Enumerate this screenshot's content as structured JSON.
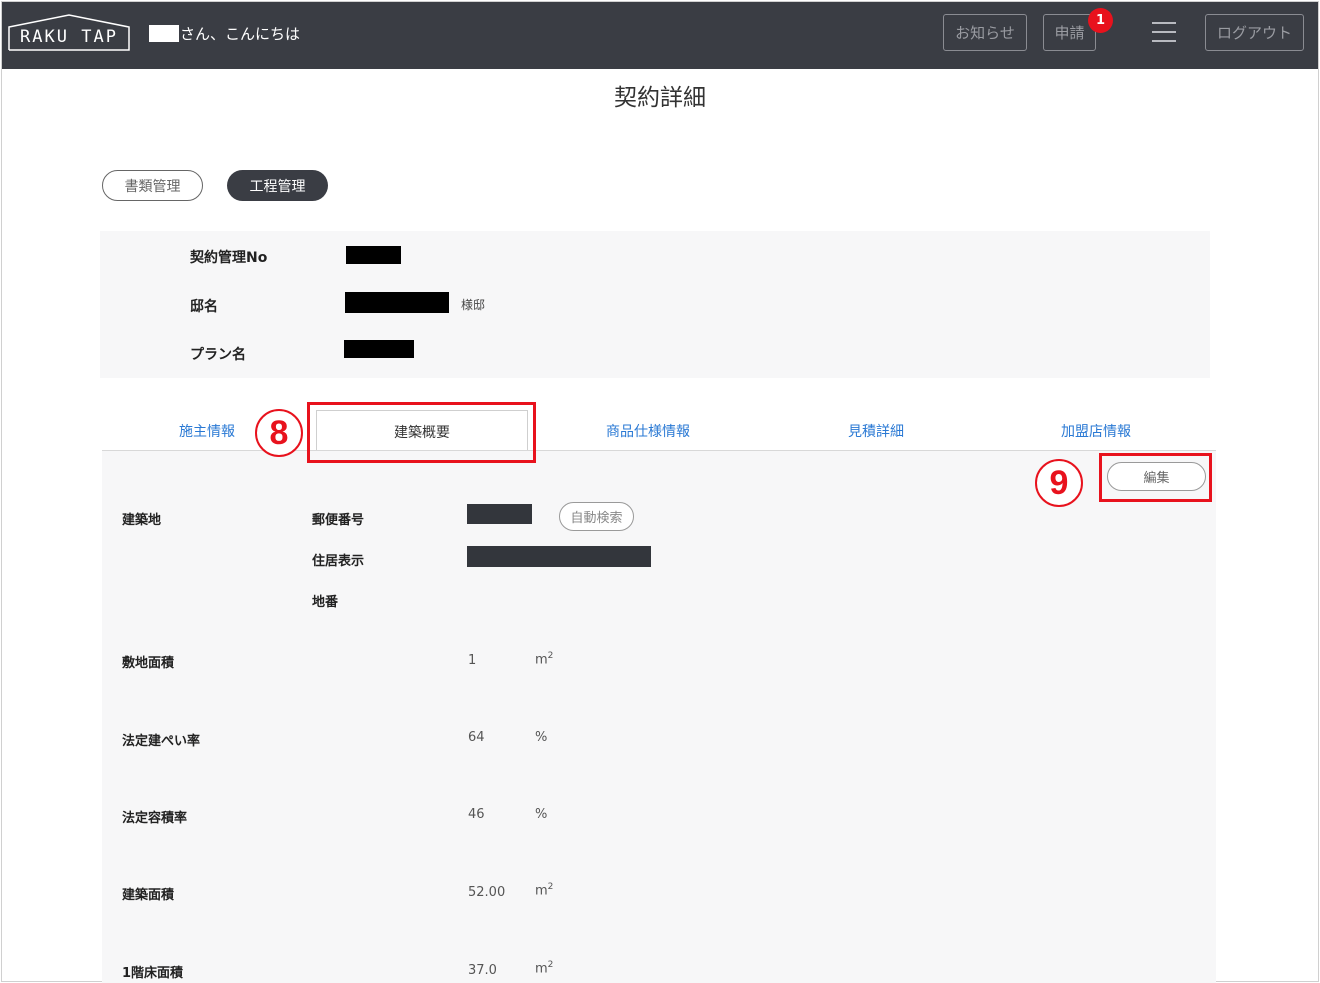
{
  "header": {
    "logo": "RAKU TAP",
    "greeting": "さん、こんにちは",
    "notice_label": "お知らせ",
    "apply_label": "申請",
    "apply_badge": "1",
    "logout_label": "ログアウト"
  },
  "page_title": "契約詳細",
  "pill_tabs": {
    "docs": "書類管理",
    "process": "工程管理"
  },
  "info": {
    "contract_no_label": "契約管理No",
    "house_name_label": "邸名",
    "house_suffix": "様邸",
    "plan_name_label": "プラン名"
  },
  "sub_tabs": {
    "owner": "施主情報",
    "building": "建築概要",
    "spec": "商品仕様情報",
    "estimate": "見積詳細",
    "dealer": "加盟店情報"
  },
  "actions": {
    "edit": "編集",
    "auto_search": "自動検索"
  },
  "fields": {
    "site_label": "建築地",
    "postal_label": "郵便番号",
    "address_label": "住居表示",
    "lot_label": "地番",
    "lot_area_label": "敷地面積",
    "lot_area_value": "1",
    "lot_area_unit": "m",
    "coverage_label": "法定建ぺい率",
    "coverage_value": "64",
    "coverage_unit": "%",
    "far_label": "法定容積率",
    "far_value": "46",
    "far_unit": "%",
    "building_area_label": "建築面積",
    "building_area_value": "52.00",
    "building_area_unit": "m",
    "floor1_label": "1階床面積",
    "floor1_value": "37.0",
    "floor1_unit": "m",
    "sq_sup": "2"
  },
  "annotations": {
    "step8": "8",
    "step9": "9"
  },
  "colors": {
    "header_bg": "#3a3d44",
    "link_blue": "#2a79d4",
    "annotation_red": "#e8121d",
    "badge_red": "#e8121d",
    "panel_bg": "#f7f7f8"
  }
}
